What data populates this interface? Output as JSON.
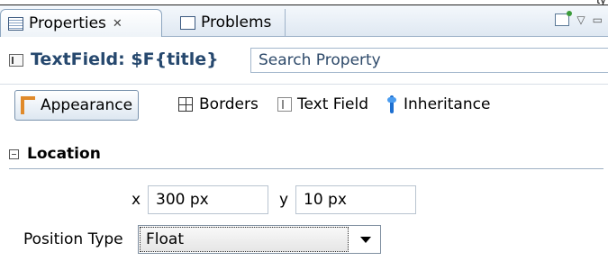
{
  "window": {
    "top_fragment": "ty"
  },
  "tabs": [
    {
      "label": "Properties",
      "close": "✕"
    },
    {
      "label": "Problems"
    }
  ],
  "element": {
    "title": "TextField: $F{title}",
    "search_placeholder": "Search Property"
  },
  "sections": [
    {
      "label": "Appearance",
      "icon": "appearance-icon"
    },
    {
      "label": "Borders",
      "icon": "borders-icon"
    },
    {
      "label": "Text Field",
      "icon": "text-field-icon"
    },
    {
      "label": "Inheritance",
      "icon": "inheritance-icon"
    }
  ],
  "location": {
    "title": "Location",
    "x_label": "x",
    "x_value": "300 px",
    "y_label": "y",
    "y_value": "10 px",
    "position_type_label": "Position Type",
    "position_type_value": "Float"
  },
  "colors": {
    "title_text": "#26486e",
    "appearance_icon": "#e08a2a",
    "inheritance_icon": "#1d6fd0"
  }
}
